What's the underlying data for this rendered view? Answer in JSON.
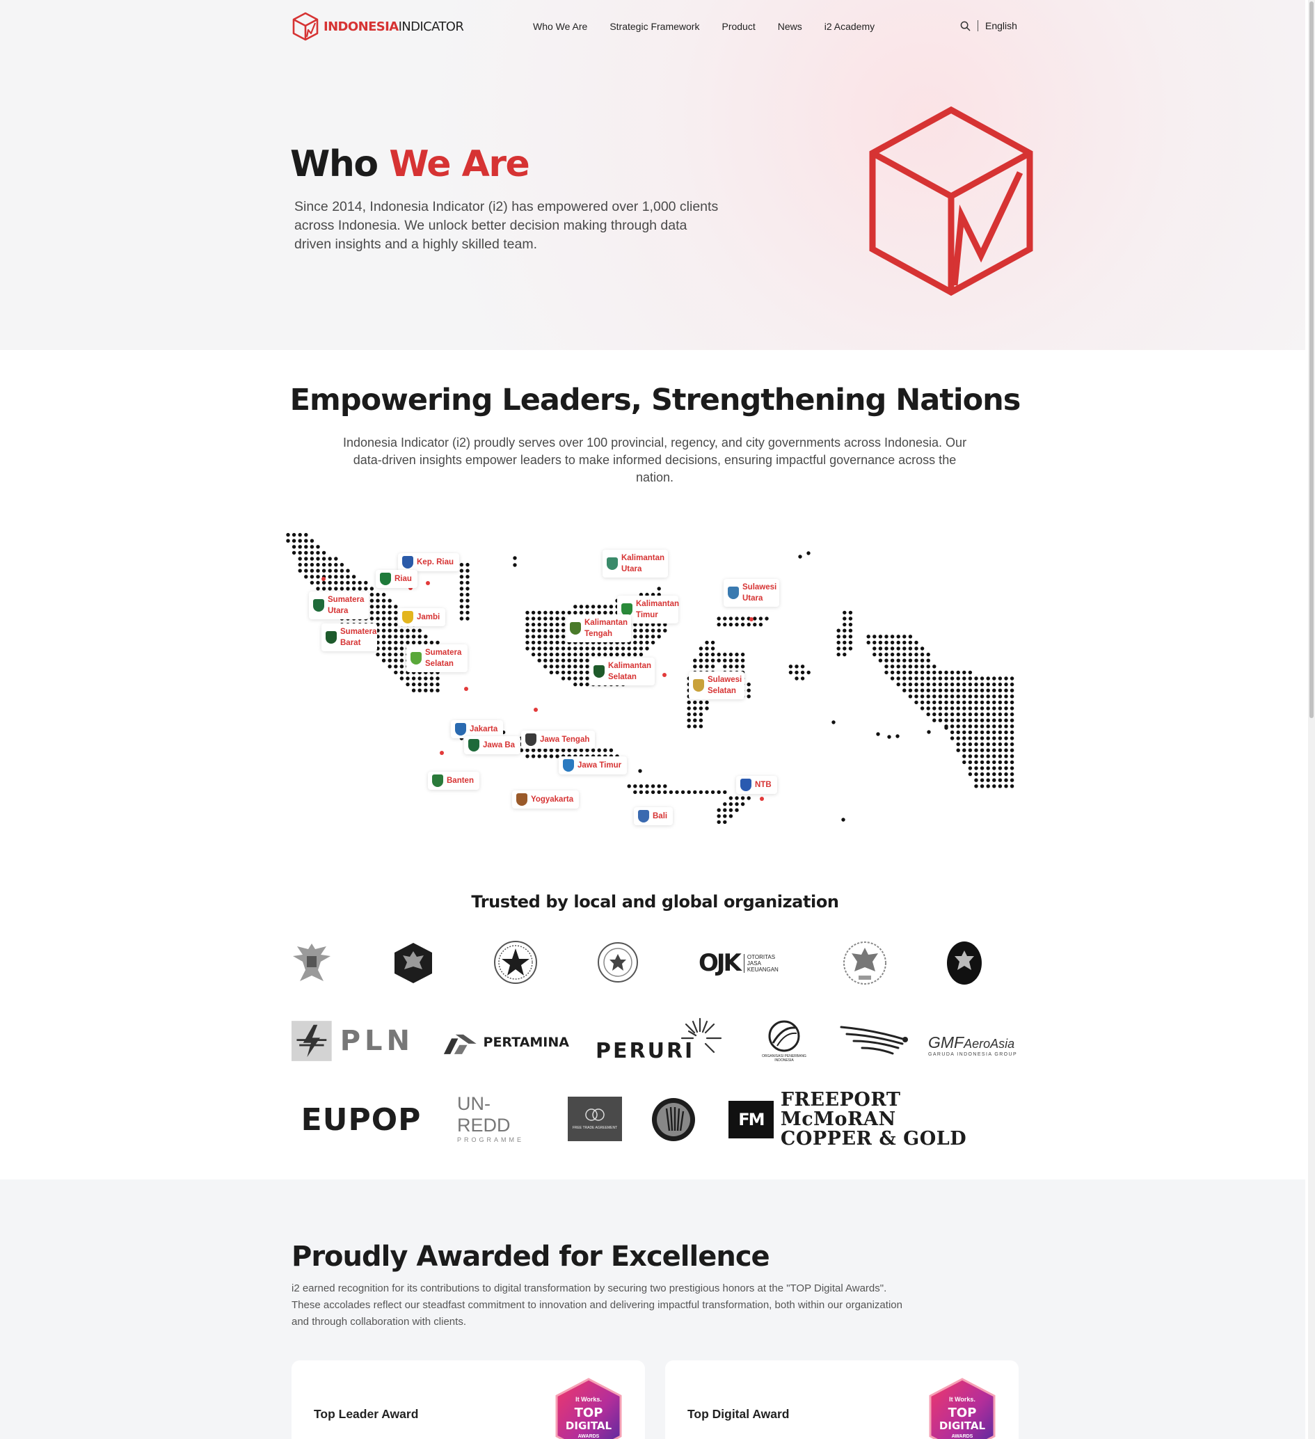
{
  "nav": {
    "logo_red": "INDONESIA",
    "logo_dark": "INDICATOR",
    "items": [
      "Who We Are",
      "Strategic Framework",
      "Product",
      "News",
      "i2 Academy"
    ],
    "language": "English",
    "search_icon": "search-icon"
  },
  "hero": {
    "title_dark": "Who",
    "title_red": "We Are",
    "description": "Since 2014, Indonesia Indicator (i2) has empowered over 1,000 clients across Indonesia. We unlock better decision making through data driven insights and a highly skilled team."
  },
  "empower": {
    "title": "Empowering Leaders, Strengthening Nations",
    "description": "Indonesia Indicator (i2) proudly serves over 100 provincial, regency, and city governments across Indonesia. Our data-driven insights empower leaders to make informed decisions, ensuring impactful governance across the nation."
  },
  "map": {
    "regions": [
      {
        "name": "Kep. Riau",
        "flag": "#2a5aa8"
      },
      {
        "name": "Riau",
        "flag": "#1e7a3a"
      },
      {
        "name": "Sumatera Utara",
        "flag": "#1f6b3a"
      },
      {
        "name": "Jambi",
        "flag": "#e3b51e"
      },
      {
        "name": "Sumatera Barat",
        "flag": "#1d5a2c"
      },
      {
        "name": "Sumatera Selatan",
        "flag": "#5aa83a"
      },
      {
        "name": "Kalimantan Utara",
        "flag": "#3a8a6a"
      },
      {
        "name": "Kalimantan Timur",
        "flag": "#2a8a3a"
      },
      {
        "name": "Kalimantan Tengah",
        "flag": "#4a7a2a"
      },
      {
        "name": "Kalimantan Selatan",
        "flag": "#1e5a2a"
      },
      {
        "name": "Sulawesi Utara",
        "flag": "#3a7ab0"
      },
      {
        "name": "Sulawesi Selatan",
        "flag": "#c9a13a"
      },
      {
        "name": "Jakarta",
        "flag": "#2a6ab0"
      },
      {
        "name": "Jawa Ba",
        "flag": "#1e6a3a"
      },
      {
        "name": "Jawa Tengah",
        "flag": "#3a3a3a"
      },
      {
        "name": "Jawa Timur",
        "flag": "#2a7ac0"
      },
      {
        "name": "Banten",
        "flag": "#2a7a3a"
      },
      {
        "name": "Yogyakarta",
        "flag": "#9a5a2a"
      },
      {
        "name": "NTB",
        "flag": "#2a5ab0"
      },
      {
        "name": "Bali",
        "flag": "#3a6ab0"
      }
    ]
  },
  "trusted": {
    "title": "Trusted by local and global organization",
    "logos": {
      "ojk_main": "OJK",
      "ojk_sub1": "OTORITAS",
      "ojk_sub2": "JASA",
      "ojk_sub3": "KEUANGAN",
      "pln": "PLN",
      "pertamina": "PERTAMINA",
      "peruri": "PERURI",
      "lapan_sub": "ORGANISASI PENERBANG INDONESIA",
      "gmf_main": "GMF",
      "gmf_aero": "AeroAsia",
      "gmf_sub": "GARUDA INDONESIA GROUP",
      "eupop": "EUPOP",
      "unredd_main": "UN-REDD",
      "unredd_sub": "PROGRAMME",
      "fta_sub": "FREE TRADE AGREEMENT",
      "freeport_1": "FREEPORT McMoRAN",
      "freeport_2": "COPPER & GOLD",
      "fm_mark": "FM"
    }
  },
  "awards": {
    "title": "Proudly Awarded for Excellence",
    "description": "i2 earned recognition for its contributions to digital transformation by securing two prestigious honors at the \"TOP Digital Awards\". These accolades reflect our steadfast commitment to innovation and delivering impactful transformation, both within our organization and through collaboration with clients.",
    "cards": [
      {
        "label": "Top Leader Award"
      },
      {
        "label": "Top Digital Award"
      }
    ],
    "badge_top": "It Works.",
    "badge_line1": "TOP",
    "badge_line2": "DIGITAL",
    "badge_line3": "AWARDS"
  },
  "colors": {
    "accent": "#d63333",
    "text": "#1b1b1b",
    "muted": "#4a4a4a"
  }
}
